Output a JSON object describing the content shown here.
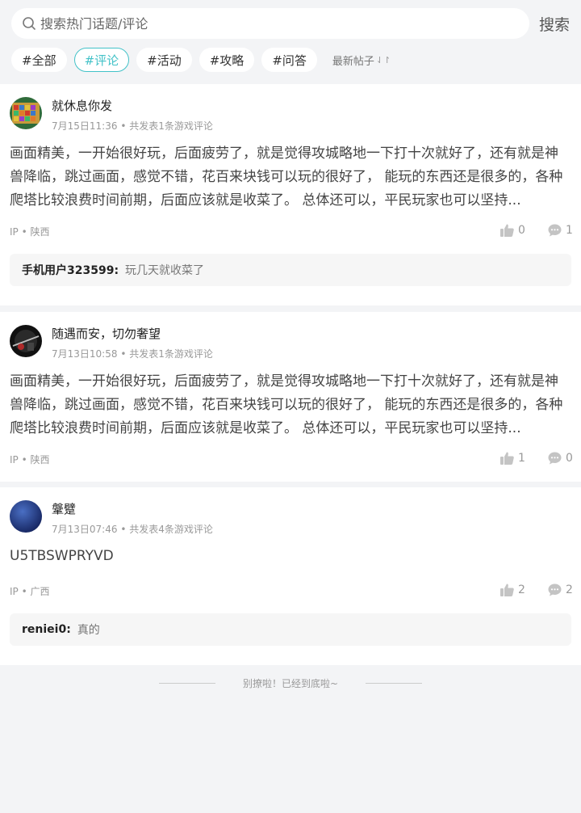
{
  "search": {
    "placeholder": "搜索热门话题/评论",
    "button_label": "搜索"
  },
  "tags": [
    {
      "label": "#全部",
      "active": false
    },
    {
      "label": "#评论",
      "active": true
    },
    {
      "label": "#活动",
      "active": false
    },
    {
      "label": "#攻略",
      "active": false
    },
    {
      "label": "#问答",
      "active": false
    }
  ],
  "sort": {
    "label": "最新帖子",
    "icon": "sort-arrows-icon"
  },
  "posts": [
    {
      "username": "就休息你发",
      "date": "7月15日11:36",
      "summary": "共发表1条游戏评论",
      "content": "画面精美，一开始很好玩，后面疲劳了，就是觉得攻城略地一下打十次就好了，还有就是神兽降临，跳过画面，感觉不错，花百来块钱可以玩的很好了， 能玩的东西还是很多的，各种爬塔比较浪费时间前期，后面应该就是收菜了。 总体还可以，平民玩家也可以坚持...",
      "ip": "IP • 陕西",
      "likes": "0",
      "comments": "1",
      "reply": {
        "user": "手机用户323599:",
        "text": "玩几天就收菜了"
      }
    },
    {
      "username": "随遇而安，切勿奢望",
      "date": "7月13日10:58",
      "summary": "共发表1条游戏评论",
      "content": "画面精美，一开始很好玩，后面疲劳了，就是觉得攻城略地一下打十次就好了，还有就是神兽降临，跳过画面，感觉不错，花百来块钱可以玩的很好了， 能玩的东西还是很多的，各种爬塔比较浪费时间前期，后面应该就是收菜了。 总体还可以，平民玩家也可以坚持...",
      "ip": "IP • 陕西",
      "likes": "1",
      "comments": "0"
    },
    {
      "username": "鞶躄",
      "date": "7月13日07:46",
      "summary": "共发表4条游戏评论",
      "content": "U5TBSWPRYVD",
      "ip": "IP • 广西",
      "likes": "2",
      "comments": "2",
      "reply": {
        "user": "reniei0:",
        "text": "真的"
      }
    }
  ],
  "footer": {
    "text": "别撩啦！已经到底啦~"
  },
  "icons": {
    "like": "thumbs-up-icon",
    "comment": "comment-bubble-icon",
    "search": "search-icon"
  },
  "colors": {
    "accent": "#43c2c8",
    "background": "#f3f4f6"
  }
}
